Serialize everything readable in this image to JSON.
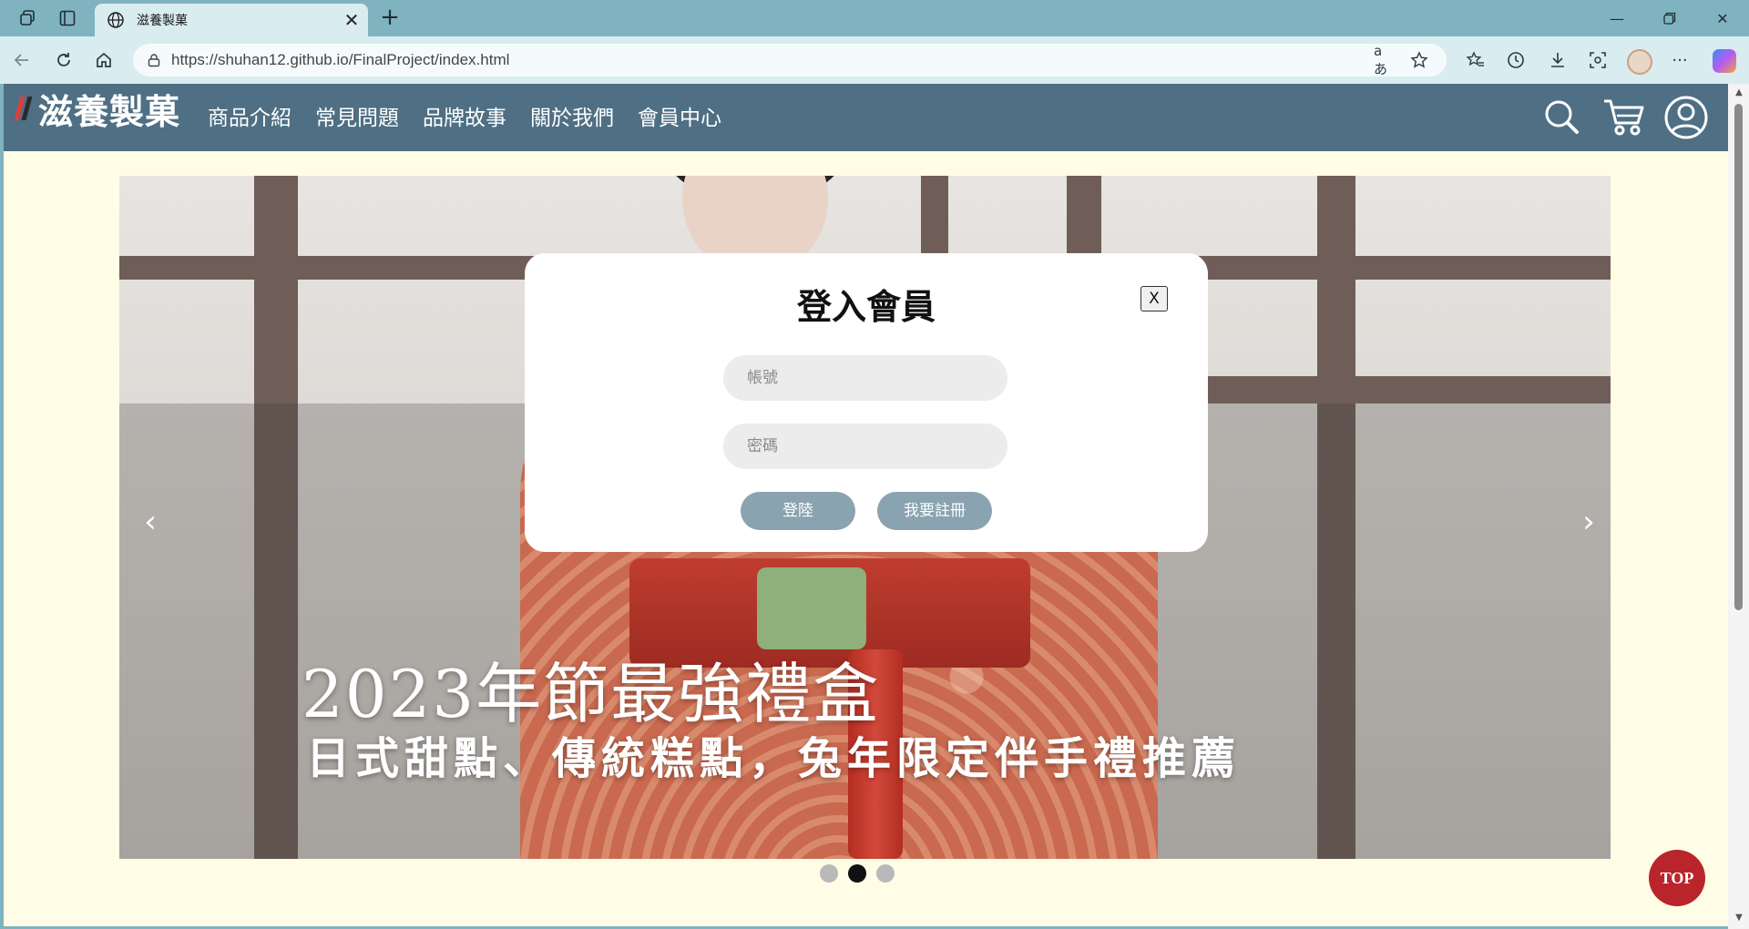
{
  "browser": {
    "tab_title": "滋養製菓",
    "url": "https://shuhan12.github.io/FinalProject/index.html",
    "read_aloud_label": "aあ"
  },
  "site": {
    "logo_text": "滋養製菓",
    "logo_colors": [
      "#e23b3b",
      "#2b2b2b"
    ],
    "header_color": "#4e6f84",
    "nav": [
      "商品介紹",
      "常見問題",
      "品牌故事",
      "關於我們",
      "會員中心"
    ]
  },
  "banner": {
    "title": "2023年節最強禮盒",
    "subtitle": "日式甜點、傳統糕點，兔年限定伴手禮推薦",
    "prev_label": "‹",
    "next_label": "›",
    "slide_count": 3,
    "active_slide": 2
  },
  "login_modal": {
    "title": "登入會員",
    "close_label": "X",
    "account_placeholder": "帳號",
    "password_placeholder": "密碼",
    "login_label": "登陸",
    "register_label": "我要註冊",
    "button_color": "#8aa3b0"
  },
  "top_button": {
    "label": "TOP",
    "color": "#b9252b"
  }
}
